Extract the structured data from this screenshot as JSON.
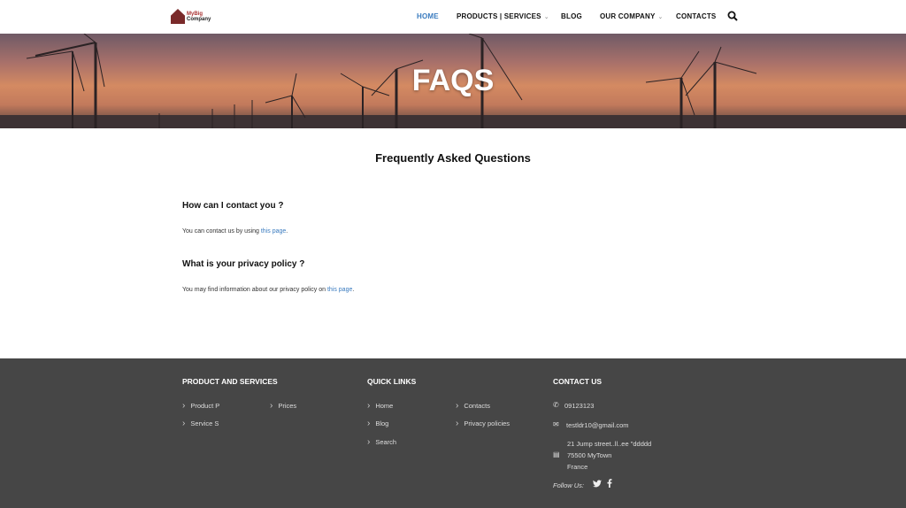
{
  "logo": {
    "line1": "MyBig",
    "line2": "Company"
  },
  "nav": {
    "items": [
      {
        "label": "HOME"
      },
      {
        "label": "PRODUCTS | SERVICES"
      },
      {
        "label": "BLOG"
      },
      {
        "label": "OUR COMPANY"
      },
      {
        "label": "CONTACTS"
      }
    ],
    "active_color": "#3a7bbf"
  },
  "hero": {
    "title": "FAQS"
  },
  "main": {
    "title": "Frequently Asked Questions",
    "faqs": [
      {
        "question": "How can I contact you ?",
        "answer": "You can contact us by using ",
        "link": "this page",
        "end": "."
      },
      {
        "question": "What is your privacy policy ?",
        "answer": "You may find information about our privacy policy on ",
        "link": "this page",
        "end": "."
      }
    ]
  },
  "footer": {
    "products": {
      "title": "PRODUCT AND SERVICES",
      "links": [
        "Product P",
        "Prices",
        "Service S"
      ]
    },
    "quick": {
      "title": "QUICK LINKS",
      "links": [
        "Home",
        "Contacts",
        "Blog",
        "Privacy policies",
        "Search"
      ]
    },
    "contact": {
      "title": "CONTACT US",
      "phone": "09123123",
      "email": "testldr10@gmail.com",
      "address": [
        "21 Jump street..ll..ee \"ddddd",
        "75500 MyTown",
        "France"
      ],
      "follow": "Follow Us:"
    }
  }
}
